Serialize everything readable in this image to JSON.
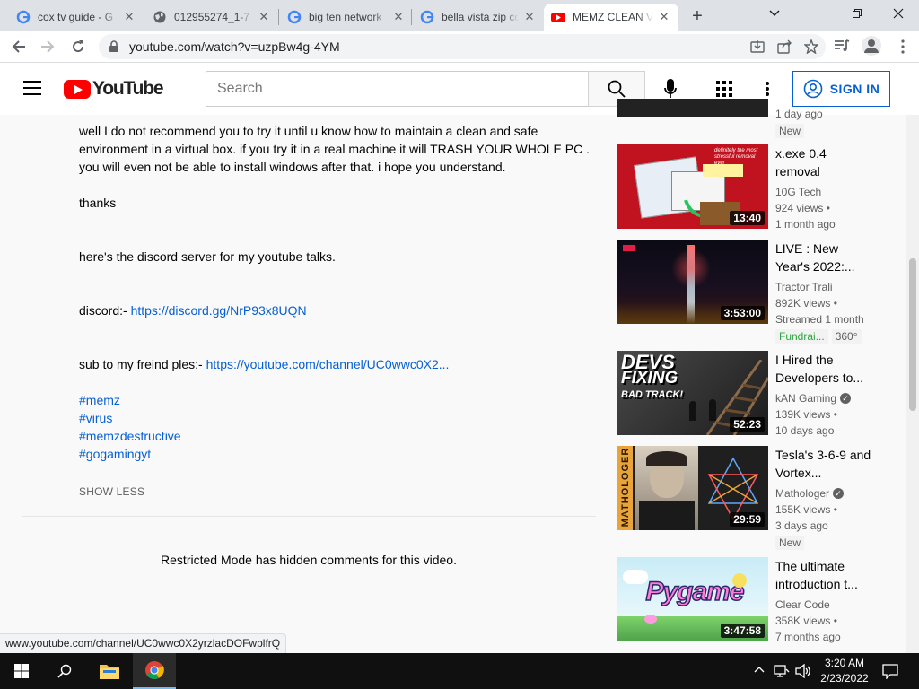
{
  "browser": {
    "tabs": [
      {
        "title": "cox tv guide - G",
        "favicon": "google-icon",
        "active": false
      },
      {
        "title": "012955274_1-7",
        "favicon": "globe-icon",
        "active": false
      },
      {
        "title": "big ten network",
        "favicon": "google-icon",
        "active": false
      },
      {
        "title": "bella vista zip co",
        "favicon": "google-icon",
        "active": false
      },
      {
        "title": "MEMZ CLEAN V",
        "favicon": "youtube-icon",
        "active": true
      }
    ],
    "url": "youtube.com/watch?v=uzpBw4g-4YM",
    "status_url": "www.youtube.com/channel/UC0wwc0X2yrzlacDOFwplfrQ"
  },
  "masthead": {
    "logo_text": "YouTube",
    "search_placeholder": "Search",
    "signin_label": "SIGN IN"
  },
  "description": {
    "para1": "well I do not recommend you to try it until u know how to maintain a clean and safe environment in a virtual box. if you try it in a real machine it will TRASH YOUR WHOLE PC . you will even not be able to install windows after that. i hope you understand.",
    "thanks": "thanks",
    "discord_intro": "here's the discord server for my youtube talks.",
    "discord_label": "discord:- ",
    "discord_link": "https://discord.gg/NrP93x8UQN",
    "sub_label": "sub to my freind ples:- ",
    "sub_link": "https://youtube.com/channel/UC0wwc0X2...",
    "hashtags": [
      "#memz",
      "#virus",
      "#memzdestructive",
      "#gogamingyt"
    ],
    "show_less": "SHOW LESS"
  },
  "comments": {
    "restricted_text": "Restricted Mode has hidden comments for this video."
  },
  "sidebar": {
    "partial_item": {
      "stat": "1 day ago",
      "badge": "New"
    },
    "videos": [
      {
        "title": "x.exe 0.4 removal",
        "channel": "10G Tech",
        "verified": false,
        "views": "924 views •",
        "age": "1 month ago",
        "duration": "13:40",
        "badges": []
      },
      {
        "title": "LIVE : New Year's 2022:...",
        "channel": "Tractor Trali",
        "verified": false,
        "views": "892K views •",
        "age": "Streamed 1 month",
        "duration": "3:53:00",
        "badges": [
          "Fundrai...",
          "360°"
        ]
      },
      {
        "title": "I Hired the Developers to...",
        "channel": "kAN Gaming",
        "verified": true,
        "views": "139K views •",
        "age": "10 days ago",
        "duration": "52:23",
        "badges": []
      },
      {
        "title": "Tesla's 3-6-9 and Vortex...",
        "channel": "Mathologer",
        "verified": true,
        "views": "155K views •",
        "age": "3 days ago",
        "duration": "29:59",
        "badges": [
          "New"
        ]
      },
      {
        "title": "The ultimate introduction t...",
        "channel": "Clear Code",
        "verified": false,
        "views": "358K views •",
        "age": "7 months ago",
        "duration": "3:47:58",
        "badges": []
      }
    ],
    "thumb_texts": {
      "v1_caption": "definitely the most stressful removal ever",
      "v3_line1": "DEVS",
      "v3_line2": "FIXING",
      "v3_line3": "BAD TRACK!",
      "v4_brand": "MATHOLOGER",
      "v5_word": "Pygame"
    }
  },
  "taskbar": {
    "time": "3:20 AM",
    "date": "2/23/2022"
  }
}
